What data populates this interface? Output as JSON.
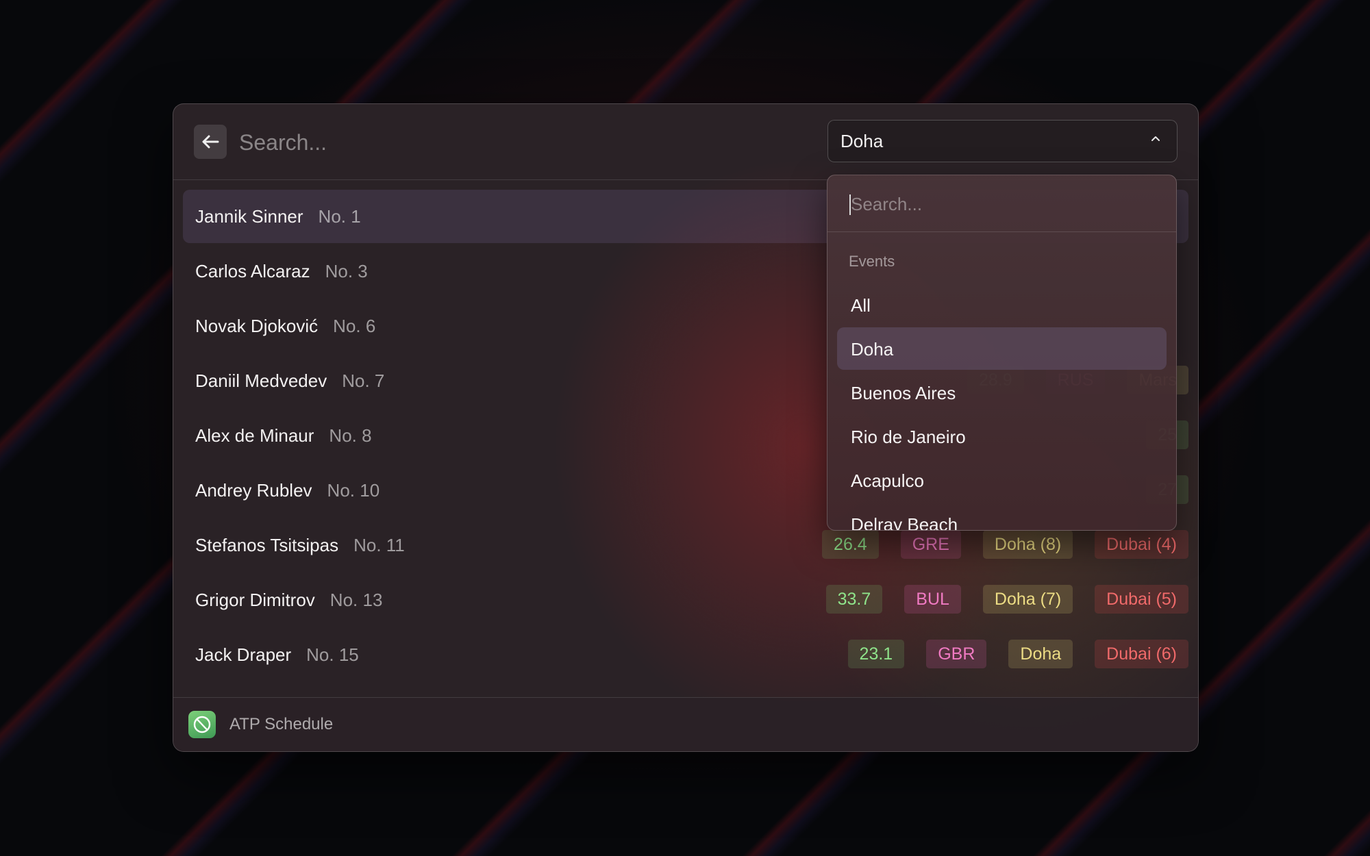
{
  "header": {
    "search_placeholder": "Search...",
    "select_value": "Doha"
  },
  "players": [
    {
      "name": "Jannik Sinner",
      "rank": "No. 1",
      "tags": []
    },
    {
      "name": "Carlos Alcaraz",
      "rank": "No. 3",
      "tags": []
    },
    {
      "name": "Novak Djoković",
      "rank": "No. 6",
      "tags": []
    },
    {
      "name": "Daniil Medvedev",
      "rank": "No. 7",
      "tags": [
        {
          "text": "28.9",
          "kind": "num"
        },
        {
          "text": "RUS",
          "kind": "cty"
        },
        {
          "text": "Mars",
          "kind": "ev1"
        }
      ]
    },
    {
      "name": "Alex de Minaur",
      "rank": "No. 8",
      "tags": [
        {
          "text": "25",
          "kind": "num"
        }
      ]
    },
    {
      "name": "Andrey Rublev",
      "rank": "No. 10",
      "tags": [
        {
          "text": "27",
          "kind": "num"
        }
      ]
    },
    {
      "name": "Stefanos Tsitsipas",
      "rank": "No. 11",
      "tags": [
        {
          "text": "26.4",
          "kind": "num"
        },
        {
          "text": "GRE",
          "kind": "cty"
        },
        {
          "text": "Doha (8)",
          "kind": "ev1"
        },
        {
          "text": "Dubai (4)",
          "kind": "ev2"
        }
      ]
    },
    {
      "name": "Grigor Dimitrov",
      "rank": "No. 13",
      "tags": [
        {
          "text": "33.7",
          "kind": "num"
        },
        {
          "text": "BUL",
          "kind": "cty"
        },
        {
          "text": "Doha (7)",
          "kind": "ev1"
        },
        {
          "text": "Dubai (5)",
          "kind": "ev2"
        }
      ]
    },
    {
      "name": "Jack Draper",
      "rank": "No. 15",
      "tags": [
        {
          "text": "23.1",
          "kind": "num"
        },
        {
          "text": "GBR",
          "kind": "cty"
        },
        {
          "text": "Doha",
          "kind": "ev1"
        },
        {
          "text": "Dubai (6)",
          "kind": "ev2"
        }
      ]
    }
  ],
  "dropdown": {
    "search_placeholder": "Search...",
    "heading": "Events",
    "items": [
      "All",
      "Doha",
      "Buenos Aires",
      "Rio de Janeiro",
      "Acapulco",
      "Delray Beach"
    ],
    "active_item": "Doha"
  },
  "footer": {
    "app_name": "ATP Schedule"
  },
  "colors": {
    "tag_number": "#8fe38a",
    "tag_country": "#f07ac2",
    "tag_event_primary": "#ecdc84",
    "tag_event_secondary": "#f06a6a",
    "app_icon": "#5cb86a"
  }
}
